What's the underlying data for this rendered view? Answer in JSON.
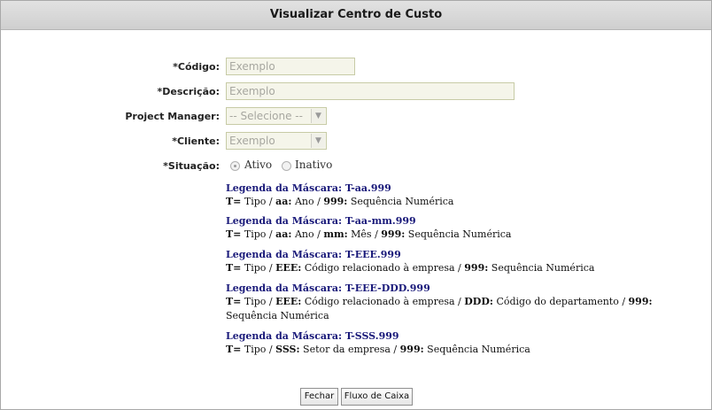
{
  "header": {
    "title": "Visualizar Centro de Custo"
  },
  "form": {
    "codigo": {
      "label": "*Código:",
      "placeholder": "Exemplo"
    },
    "descricao": {
      "label": "*Descrição:",
      "placeholder": "Exemplo"
    },
    "project_manager": {
      "label": "Project Manager:",
      "value": "-- Selecione --"
    },
    "cliente": {
      "label": "*Cliente:",
      "value": "Exemplo"
    },
    "situacao": {
      "label": "*Situação:",
      "options": [
        "Ativo",
        "Inativo"
      ],
      "selected": "Ativo"
    }
  },
  "legends": [
    {
      "title": "Legenda da Máscara: T-aa.999",
      "parts": [
        [
          "T=",
          " Tipo / "
        ],
        [
          "aa:",
          " Ano / "
        ],
        [
          "999:",
          " Sequência Numérica"
        ]
      ]
    },
    {
      "title": "Legenda da Máscara: T-aa-mm.999",
      "parts": [
        [
          "T=",
          " Tipo / "
        ],
        [
          "aa:",
          " Ano / "
        ],
        [
          "mm:",
          " Mês / "
        ],
        [
          "999:",
          " Sequência Numérica"
        ]
      ]
    },
    {
      "title": "Legenda da Máscara: T-EEE.999",
      "parts": [
        [
          "T=",
          " Tipo / "
        ],
        [
          "EEE:",
          " Código relacionado à empresa / "
        ],
        [
          "999:",
          " Sequência Numérica"
        ]
      ]
    },
    {
      "title": "Legenda da Máscara: T-EEE-DDD.999",
      "parts": [
        [
          "T=",
          " Tipo / "
        ],
        [
          "EEE:",
          " Código relacionado à empresa / "
        ],
        [
          "DDD:",
          " Código do departamento / "
        ],
        [
          "999:",
          " Sequência Numérica"
        ]
      ]
    },
    {
      "title": "Legenda da Máscara: T-SSS.999",
      "parts": [
        [
          "T=",
          " Tipo / "
        ],
        [
          "SSS:",
          " Setor da empresa / "
        ],
        [
          "999:",
          " Sequência Numérica"
        ]
      ]
    }
  ],
  "buttons": {
    "fechar": "Fechar",
    "fluxo": "Fluxo de Caixa"
  }
}
